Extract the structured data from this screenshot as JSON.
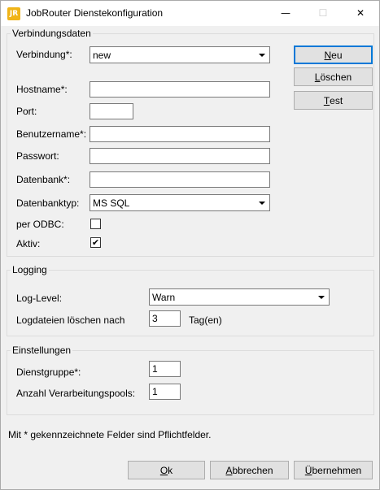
{
  "window": {
    "icon_text": "JR",
    "title": "JobRouter Dienstekonfiguration",
    "min_glyph": "—",
    "max_glyph": "☐",
    "close_glyph": "✕"
  },
  "connection": {
    "group_title": "Verbindungsdaten",
    "verbindung_label": "Verbindung*:",
    "verbindung_value": "new",
    "hostname_label": "Hostname*:",
    "hostname_value": "",
    "port_label": "Port:",
    "port_value": "",
    "benutzername_label": "Benutzername*:",
    "benutzername_value": "",
    "passwort_label": "Passwort:",
    "passwort_value": "",
    "datenbank_label": "Datenbank*:",
    "datenbank_value": "",
    "datenbanktyp_label": "Datenbanktyp:",
    "datenbanktyp_value": "MS SQL",
    "odbc_label": "per ODBC:",
    "odbc_checked": false,
    "aktiv_label": "Aktiv:",
    "aktiv_checked": true,
    "check_glyph": "✔",
    "btn_neu_pre": "",
    "btn_neu_key": "N",
    "btn_neu_post": "eu",
    "btn_loeschen_pre": "",
    "btn_loeschen_key": "L",
    "btn_loeschen_post": "öschen",
    "btn_test_pre": "",
    "btn_test_key": "T",
    "btn_test_post": "est"
  },
  "logging": {
    "group_title": "Logging",
    "level_label": "Log-Level:",
    "level_value": "Warn",
    "delete_label": "Logdateien löschen nach",
    "delete_value": "3",
    "delete_unit": "Tag(en)"
  },
  "settings": {
    "group_title": "Einstellungen",
    "dienstgruppe_label": "Dienstgruppe*:",
    "dienstgruppe_value": "1",
    "pools_label": "Anzahl Verarbeitungspools:",
    "pools_value": "1"
  },
  "footer": {
    "note": "Mit * gekennzeichnete Felder sind Pflichtfelder.",
    "ok_pre": "",
    "ok_key": "O",
    "ok_post": "k",
    "abbrechen_pre": "",
    "abbrechen_key": "A",
    "abbrechen_post": "bbrechen",
    "uebernehmen_pre": "",
    "uebernehmen_key": "Ü",
    "uebernehmen_post": "bernehmen"
  }
}
